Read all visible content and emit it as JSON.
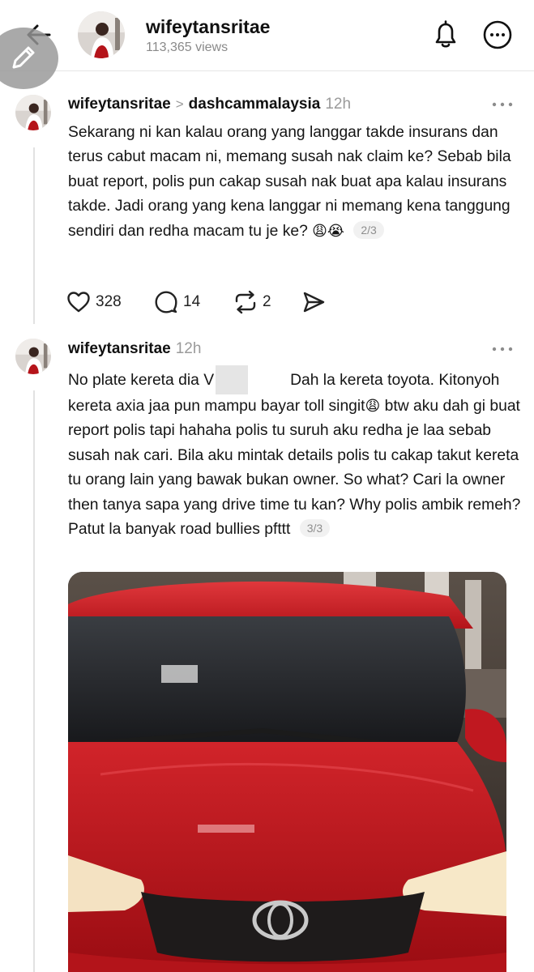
{
  "header": {
    "title": "wifeytansritae",
    "views": "113,365 views"
  },
  "posts": [
    {
      "username": "wifeytansritae",
      "reply_to": "dashcammalaysia",
      "time": "12h",
      "text": "Sekarang ni kan kalau orang yang langgar takde insurans dan terus cabut macam ni, memang susah nak claim ke? Sebab bila buat report, polis pun cakap susah nak buat apa kalau insurans takde. Jadi orang yang kena langgar ni memang kena tanggung sendiri dan redha macam tu je ke?",
      "emojis": "😩😭",
      "counter": "2/3",
      "likes": "328",
      "replies": "14",
      "reposts": "2"
    },
    {
      "username": "wifeytansritae",
      "time": "12h",
      "text_start": "No plate kereta dia V",
      "text_rest": "Dah la kereta toyota. Kitonyoh kereta axia jaa pun mampu bayar toll singit",
      "emoji_mid": "😩",
      "text_end": " btw aku dah gi buat report polis tapi hahaha polis tu suruh aku redha je laa sebab susah nak cari. Bila aku mintak details polis tu cakap takut kereta tu orang lain yang bawak bukan owner. So what? Cari la owner then tanya sapa yang drive time tu kan? Why polis ambik remeh? Patut la banyak road bullies pfttt",
      "counter": "3/3"
    }
  ],
  "icons": {
    "back": "arrow-left-icon",
    "bell": "bell-icon",
    "more": "more-horizontal-icon",
    "compose": "pencil-icon",
    "like": "heart-icon",
    "reply": "comment-icon",
    "repost": "repost-icon",
    "share": "send-icon"
  },
  "colors": {
    "muted": "#9a9a9a",
    "text": "#151515",
    "car": "#c8141c"
  }
}
